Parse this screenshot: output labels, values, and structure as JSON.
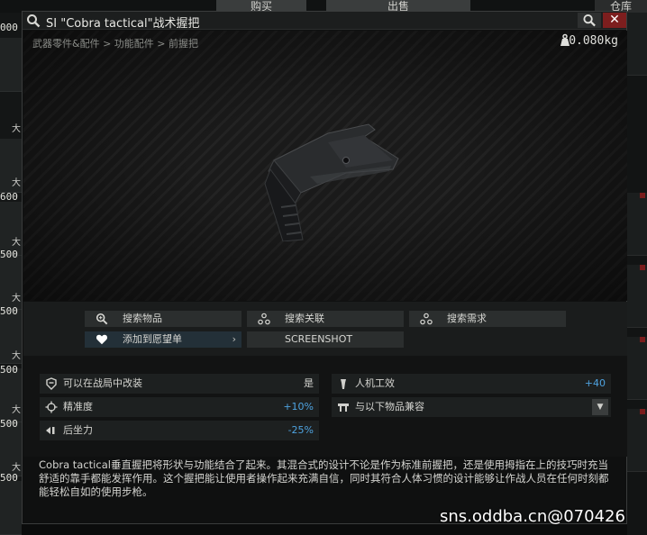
{
  "background": {
    "tabs": [
      "购买",
      "出售",
      "仓库"
    ],
    "left_prices": [
      "000",
      "600",
      "500",
      "500",
      "500",
      "500",
      "500"
    ],
    "left_tag": "大"
  },
  "window": {
    "title": "SI \"Cobra tactical\"战术握把",
    "close_label": "✕",
    "breadcrumb": "武器零件&配件 > 功能配件 > 前握把",
    "weight": "0.080kg"
  },
  "actions": {
    "search_item": "搜索物品",
    "search_related": "搜索关联",
    "search_requirement": "搜索需求",
    "add_wishlist": "添加到愿望单",
    "screenshot": "SCREENSHOT"
  },
  "properties": {
    "modifiable": {
      "label": "可以在战局中改装",
      "value": "是"
    },
    "ergonomics": {
      "label": "人机工效",
      "value": "+40"
    },
    "accuracy": {
      "label": "精准度",
      "value": "+10%"
    },
    "compatible": {
      "label": "与以下物品兼容"
    },
    "recoil": {
      "label": "后坐力",
      "value": "-25%"
    }
  },
  "description": "Cobra tactical垂直握把将形状与功能结合了起来。其混合式的设计不论是作为标准前握把，还是使用拇指在上的技巧时充当舒适的靠手都能发挥作用。这个握把能让使用者操作起来充满自信，同时其符合人体习惯的设计能够让作战人员在任何时刻都能轻松自如的使用步枪。",
  "watermark": "sns.oddba.cn@070426",
  "colors": {
    "accent_blue": "#4ea3e0",
    "close_red": "#7d1e1e"
  }
}
